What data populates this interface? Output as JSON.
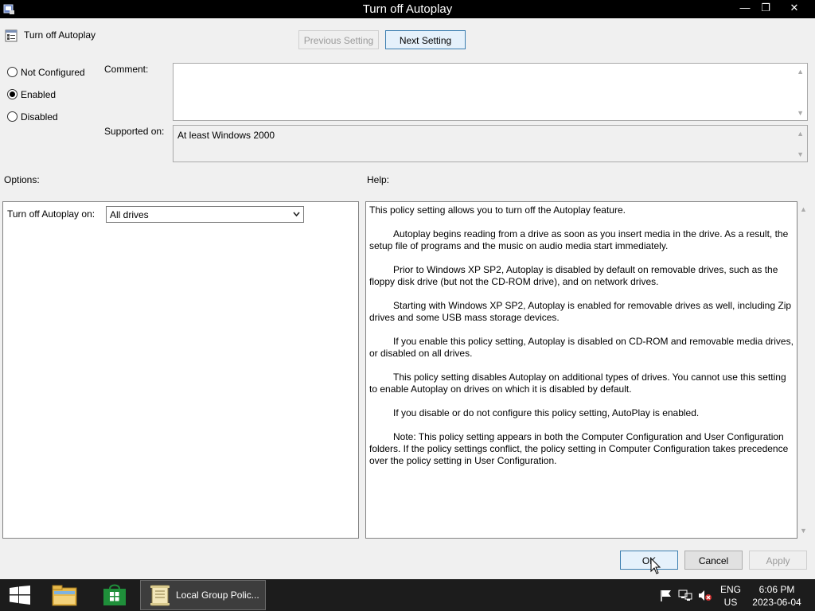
{
  "window": {
    "title": "Turn off Autoplay",
    "controls": {
      "minimize": "—",
      "restore": "❐",
      "close": "✕"
    }
  },
  "header": {
    "policy_name": "Turn off Autoplay",
    "previous_label": "Previous Setting",
    "next_label": "Next Setting"
  },
  "state": {
    "options": [
      {
        "label": "Not Configured",
        "checked": false
      },
      {
        "label": "Enabled",
        "checked": true
      },
      {
        "label": "Disabled",
        "checked": false
      }
    ]
  },
  "comment": {
    "label": "Comment:",
    "value": ""
  },
  "supported": {
    "label": "Supported on:",
    "value": "At least Windows 2000"
  },
  "options_section": {
    "label": "Options:",
    "field_label": "Turn off Autoplay on:",
    "selected": "All drives"
  },
  "help_section": {
    "label": "Help:",
    "paragraphs": [
      "This policy setting allows you to turn off the Autoplay feature.",
      "Autoplay begins reading from a drive as soon as you insert media in the drive. As a result, the setup file of programs and the music on audio media start immediately.",
      "Prior to Windows XP SP2, Autoplay is disabled by default on removable drives, such as the floppy disk drive (but not the CD-ROM drive), and on network drives.",
      "Starting with Windows XP SP2, Autoplay is enabled for removable drives as well, including Zip drives and some USB mass storage devices.",
      "If you enable this policy setting, Autoplay is disabled on CD-ROM and removable media drives, or disabled on all drives.",
      "This policy setting disables Autoplay on additional types of drives. You cannot use this setting to enable Autoplay on drives on which it is disabled by default.",
      "If you disable or do not configure this policy setting, AutoPlay is enabled.",
      "Note: This policy setting appears in both the Computer Configuration and User Configuration folders. If the policy settings conflict, the policy setting in Computer Configuration takes precedence over the policy setting in User Configuration."
    ]
  },
  "footer": {
    "ok": "OK",
    "cancel": "Cancel",
    "apply": "Apply"
  },
  "taskbar": {
    "active_task": "Local Group Polic...",
    "language": "ENG",
    "region": "US",
    "time": "6:06 PM",
    "date": "2023-06-04"
  }
}
